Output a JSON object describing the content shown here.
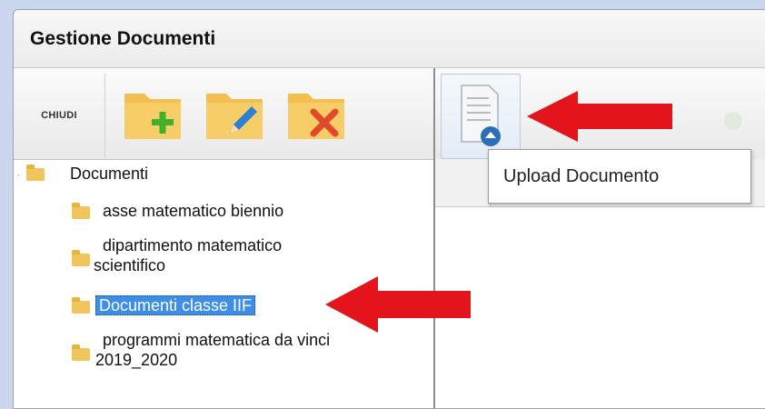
{
  "window": {
    "title": "Gestione Documenti"
  },
  "left_toolbar": {
    "close_label": "CHIUDI",
    "buttons": [
      {
        "name": "add-folder",
        "icon": "folder-plus-icon"
      },
      {
        "name": "edit-folder",
        "icon": "folder-edit-icon"
      },
      {
        "name": "delete-folder",
        "icon": "folder-delete-icon"
      }
    ]
  },
  "tree": {
    "root": "Documenti",
    "items": [
      {
        "line1": "asse matematico biennio",
        "line2": ""
      },
      {
        "line1": "dipartimento matematico",
        "line2": "scientifico"
      },
      {
        "line1": "Documenti classe IIF",
        "line2": "",
        "selected": true
      },
      {
        "line1": "programmi matematica da vinci",
        "line2": "2019_2020"
      }
    ]
  },
  "right_toolbar": {
    "upload_icon": "document-upload-icon"
  },
  "tooltip": {
    "text": "Upload Documento"
  },
  "colors": {
    "selection": "#3d8ee6",
    "arrow": "#e3141b",
    "folder": "#f2c55a"
  }
}
